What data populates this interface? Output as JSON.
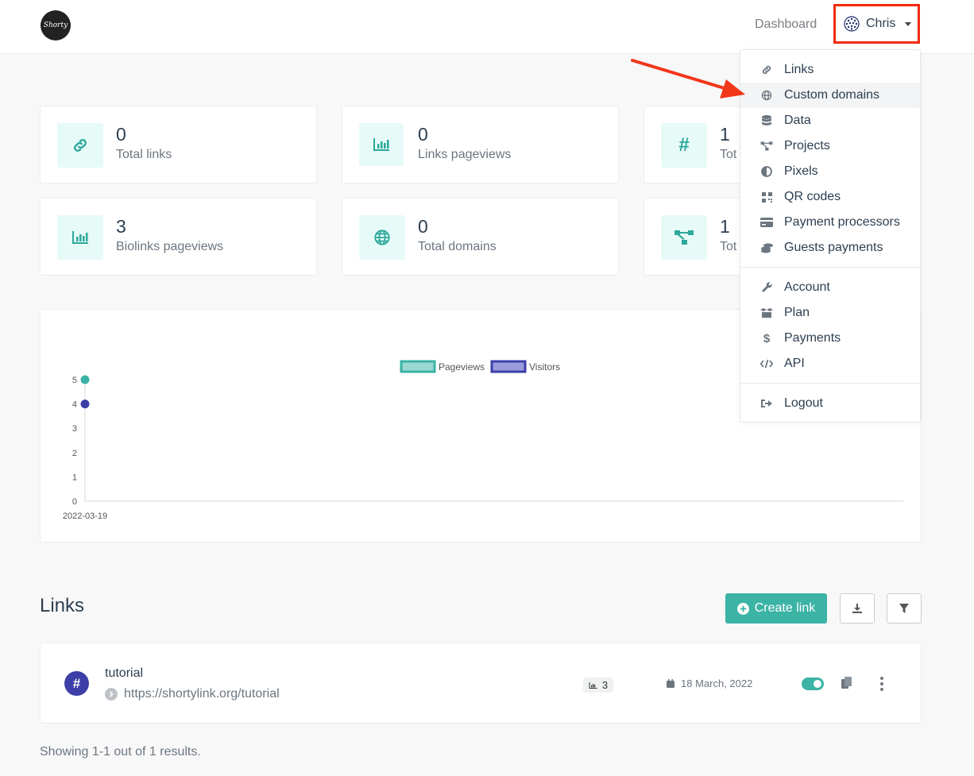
{
  "header": {
    "logo_text": "Shorty",
    "nav_dashboard": "Dashboard",
    "user_name": "Chris"
  },
  "stats": [
    {
      "value": "0",
      "label": "Total links",
      "icon": "link-icon"
    },
    {
      "value": "0",
      "label": "Links pageviews",
      "icon": "bar-chart-icon"
    },
    {
      "value": "1",
      "label": "Tot",
      "icon": "hashtag-icon"
    },
    {
      "value": "3",
      "label": "Biolinks pageviews",
      "icon": "bar-chart-icon"
    },
    {
      "value": "0",
      "label": "Total domains",
      "icon": "globe-icon"
    },
    {
      "value": "1",
      "label": "Tot",
      "icon": "project-diagram-icon"
    }
  ],
  "chart_data": {
    "type": "line",
    "categories": [
      "2022-03-19"
    ],
    "series": [
      {
        "name": "Pageviews",
        "values": [
          5
        ],
        "color": "#3bb3a5"
      },
      {
        "name": "Visitors",
        "values": [
          4
        ],
        "color": "#3c3fa8"
      }
    ],
    "yticks": [
      "5",
      "4",
      "3",
      "2",
      "1",
      "0"
    ],
    "ylim": [
      0,
      5
    ],
    "legend_position": "top-center"
  },
  "links_section": {
    "title": "Links",
    "create_label": "Create link",
    "showing_text": "Showing 1-1 out of 1 results."
  },
  "link_row": {
    "name": "tutorial",
    "url": "https://shortylink.org/tutorial",
    "pageviews": "3",
    "date": "18 March, 2022",
    "enabled": true
  },
  "dropdown": {
    "items": [
      {
        "label": "Links",
        "icon": "link-icon"
      },
      {
        "label": "Custom domains",
        "icon": "globe-icon"
      },
      {
        "label": "Data",
        "icon": "database-icon"
      },
      {
        "label": "Projects",
        "icon": "project-diagram-icon"
      },
      {
        "label": "Pixels",
        "icon": "adjust-icon"
      },
      {
        "label": "QR codes",
        "icon": "qrcode-icon"
      },
      {
        "label": "Payment processors",
        "icon": "credit-card-icon"
      },
      {
        "label": "Guests payments",
        "icon": "coins-icon"
      },
      {
        "label": "Account",
        "icon": "wrench-icon"
      },
      {
        "label": "Plan",
        "icon": "box-icon"
      },
      {
        "label": "Payments",
        "icon": "dollar-icon"
      },
      {
        "label": "API",
        "icon": "code-icon"
      },
      {
        "label": "Logout",
        "icon": "sign-out-icon"
      }
    ]
  },
  "colors": {
    "accent": "#3bb3a5",
    "secondary": "#3c3fa8",
    "highlight": "#f22a10"
  }
}
